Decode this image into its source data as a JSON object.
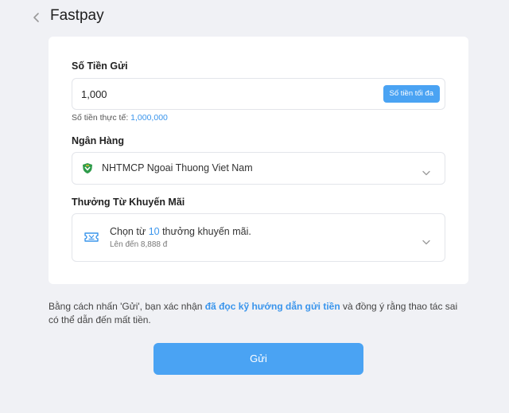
{
  "header": {
    "title": "Fastpay"
  },
  "amount": {
    "label": "Số Tiền Gửi",
    "value": "1,000",
    "max_button": "Số tiền tối đa",
    "actual_prefix": "Số tiền thực tế:",
    "actual_value": "1,000,000"
  },
  "bank": {
    "label": "Ngân Hàng",
    "selected": "NHTMCP Ngoai Thuong Viet Nam",
    "icon": "bank-shield-icon",
    "icon_color": "#2e9b4a"
  },
  "promo": {
    "label": "Thưởng Từ Khuyến Mãi",
    "text_prefix": "Chọn từ",
    "count": "10",
    "text_suffix": "thưởng khuyến mãi.",
    "subtext": "Lên đến 8,888 đ"
  },
  "notice": {
    "prefix": "Bằng cách nhấn 'Gửi', bạn xác nhận",
    "link": "đã đọc kỹ hướng dẫn gửi tiền",
    "suffix": "và đồng ý rằng thao tác sai có thể dẫn đến mất tiền."
  },
  "submit": {
    "label": "Gửi"
  },
  "colors": {
    "accent": "#4aa3f3",
    "background": "#f0f1f5",
    "link": "#3a95ec"
  }
}
